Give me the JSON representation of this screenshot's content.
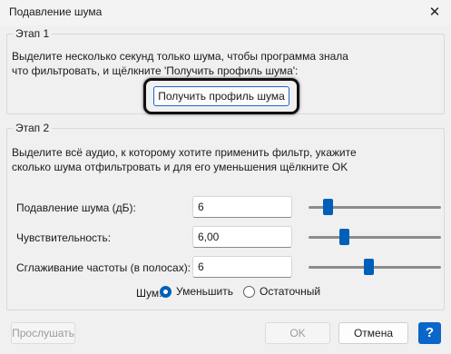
{
  "window": {
    "title": "Подавление шума",
    "close_icon": "✕"
  },
  "step1": {
    "legend": "Этап 1",
    "line1": "Выделите несколько секунд только шума, чтобы программа знала",
    "line2": "что фильтровать, и щёлкните 'Получить профиль шума':",
    "button_label": "Получить профиль шума"
  },
  "step2": {
    "legend": "Этап 2",
    "line1": "Выделите всё аудио, к которому хотите применить фильтр, укажите",
    "line2": "сколько шума отфильтровать и для его уменьшения щёлкните OK",
    "params": [
      {
        "label": "Подавление шума (дБ):",
        "value": "6",
        "slider_fraction": 0.12
      },
      {
        "label": "Чувствительность:",
        "value": "6,00",
        "slider_fraction": 0.25
      },
      {
        "label": "Сглаживание частоты (в полосах):",
        "value": "6",
        "slider_fraction": 0.45
      }
    ],
    "noise_label": "Шум:",
    "radio_reduce": "Уменьшить",
    "radio_residual": "Остаточный",
    "selected": "reduce"
  },
  "footer": {
    "preview_label": "Прослушать",
    "ok_label": "OK",
    "cancel_label": "Отмена",
    "help_label": "?"
  },
  "colors": {
    "accent": "#005fb8",
    "help_button": "#0a66c9"
  }
}
